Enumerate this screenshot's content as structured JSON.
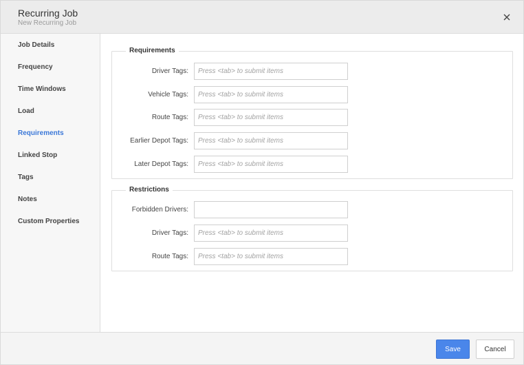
{
  "header": {
    "title": "Recurring Job",
    "subtitle": "New Recurring Job",
    "close_icon": "close-icon"
  },
  "sidebar": {
    "items": [
      {
        "label": "Job Details"
      },
      {
        "label": "Frequency"
      },
      {
        "label": "Time Windows"
      },
      {
        "label": "Load"
      },
      {
        "label": "Requirements",
        "active": true
      },
      {
        "label": "Linked Stop"
      },
      {
        "label": "Tags"
      },
      {
        "label": "Notes"
      },
      {
        "label": "Custom Properties"
      }
    ],
    "active_color": "#3b78d8"
  },
  "requirements": {
    "legend": "Requirements",
    "fields": [
      {
        "label": "Driver Tags:",
        "placeholder": "Press <tab> to submit items",
        "value": ""
      },
      {
        "label": "Vehicle Tags:",
        "placeholder": "Press <tab> to submit items",
        "value": ""
      },
      {
        "label": "Route Tags:",
        "placeholder": "Press <tab> to submit items",
        "value": ""
      },
      {
        "label": "Earlier Depot Tags:",
        "placeholder": "Press <tab> to submit items",
        "value": ""
      },
      {
        "label": "Later Depot Tags:",
        "placeholder": "Press <tab> to submit items",
        "value": ""
      }
    ]
  },
  "restrictions": {
    "legend": "Restrictions",
    "fields": [
      {
        "label": "Forbidden Drivers:",
        "placeholder": "",
        "value": ""
      },
      {
        "label": "Driver Tags:",
        "placeholder": "Press <tab> to submit items",
        "value": ""
      },
      {
        "label": "Route Tags:",
        "placeholder": "Press <tab> to submit items",
        "value": ""
      }
    ]
  },
  "footer": {
    "save_label": "Save",
    "cancel_label": "Cancel",
    "save_color": "#4a86ea"
  }
}
